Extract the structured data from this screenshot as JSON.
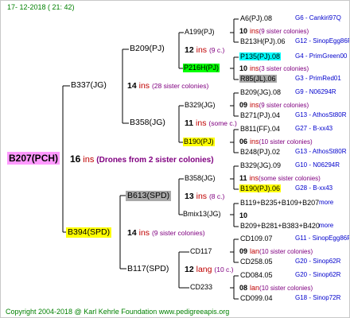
{
  "date": "17- 12-2018 ( 21: 42)",
  "footer": "Copyright 2004-2018 @ Karl Kehrle Foundation   www.pedigreeapis.org",
  "root": {
    "name": "B207(PCH)",
    "count": "16",
    "ins": "ins",
    "note": "(Drones from 2 sister colonies)"
  },
  "g1": [
    {
      "name": "B337(JG)",
      "count": "14",
      "ins": "ins",
      "note": "(28 sister colonies)"
    },
    {
      "name": "B394(SPD)",
      "count": "14",
      "ins": "ins",
      "note": "(9 sister colonies)"
    }
  ],
  "g2": [
    {
      "name": "B209(PJ)",
      "count": "12",
      "ins": "ins",
      "note": "(9 c.)"
    },
    {
      "name": "B358(JG)",
      "count": "11",
      "ins": "ins",
      "note": "(some c.)"
    },
    {
      "name": "B613(SPD)",
      "count": "13",
      "ins": "ins",
      "note": "(8 c.)"
    },
    {
      "name": "B117(SPD)",
      "count": "12",
      "ins": "lang",
      "note": "(10 c.)"
    }
  ],
  "g3": [
    {
      "name": "A199(PJ)"
    },
    {
      "name": "P216H(PJ)"
    },
    {
      "name": "B329(JG)"
    },
    {
      "name": "B190(PJ)"
    },
    {
      "name": "B358(JG)"
    },
    {
      "name": "Bmix13(JG)"
    },
    {
      "name": "CD117"
    },
    {
      "name": "CD233"
    }
  ],
  "g3info": [
    {
      "count": "12",
      "ins": "ins",
      "note": "(9 c.)"
    },
    {
      "count": "10",
      "ins": "ins",
      "note": "(3 sister colonies)"
    },
    {
      "count": "09",
      "ins": "ins",
      "note": "(9 sister colonies)"
    },
    {
      "count": "06",
      "ins": "ins",
      "note": "(10 sister colonies)"
    },
    {
      "count": "11",
      "ins": "ins",
      "note": "(some sister colonies)"
    },
    {
      "count": "10",
      "ins": "",
      "note": ""
    },
    {
      "count": "09",
      "ins": "lan",
      "note": "(10 sister colonies)"
    },
    {
      "count": "08",
      "ins": "lan",
      "note": "(10 sister colonies)"
    }
  ],
  "g4": [
    {
      "name": "A6(PJ).08",
      "code": "G6 - Cankiri97Q"
    },
    {
      "name": "10",
      "count_only": true,
      "ins": "ins",
      "note": "(9 sister colonies)"
    },
    {
      "name": "B213H(PJ).06",
      "code": "G12 - SinopEgg86R"
    },
    {
      "name": "P135(PJ).08",
      "code": "G4 - PrimGreen00"
    },
    {
      "name": "10",
      "count_only": true,
      "ins": "ins",
      "note": "(3 sister colonies)"
    },
    {
      "name": "R85(JL).06",
      "code": "G3 - PrimRed01"
    },
    {
      "name": "B209(JG).08",
      "code": "G9 - N06294R"
    },
    {
      "name": "09",
      "count_only": true,
      "ins": "ins",
      "note": "(9 sister colonies)"
    },
    {
      "name": "B271(PJ).04",
      "code": "G13 - AthosSt80R"
    },
    {
      "name": "B811(FF).04",
      "code": "G27 - B-xx43"
    },
    {
      "name": "06",
      "count_only": true,
      "ins": "ins",
      "note": "(10 sister colonies)"
    },
    {
      "name": "B248(PJ).02",
      "code": "G13 - AthosSt80R"
    },
    {
      "name": "B329(JG).09",
      "code": "G10 - N06294R"
    },
    {
      "name": "11",
      "count_only": true,
      "ins": "ins",
      "note": "(some sister colonies)"
    },
    {
      "name": "B190(PJ).06",
      "code": "G28 - B-xx43"
    },
    {
      "name": "B119+B235+B109+B207",
      "code": "more"
    },
    {
      "name": "10",
      "count_only": true,
      "ins": "",
      "note": ""
    },
    {
      "name": "B209+B281+B383+B420",
      "code": "more"
    },
    {
      "name": "CD109.07",
      "code": "G11 - SinopEgg86R"
    },
    {
      "name": "09",
      "count_only": true,
      "ins": "lan",
      "note": "(10 sister colonies)"
    },
    {
      "name": "CD258.05",
      "code": "G20 - Sinop62R"
    },
    {
      "name": "CD084.05",
      "code": "G20 - Sinop62R"
    },
    {
      "name": "08",
      "count_only": true,
      "ins": "lan",
      "note": "(10 sister colonies)"
    },
    {
      "name": "CD099.04",
      "code": "G18 - Sinop72R"
    }
  ]
}
